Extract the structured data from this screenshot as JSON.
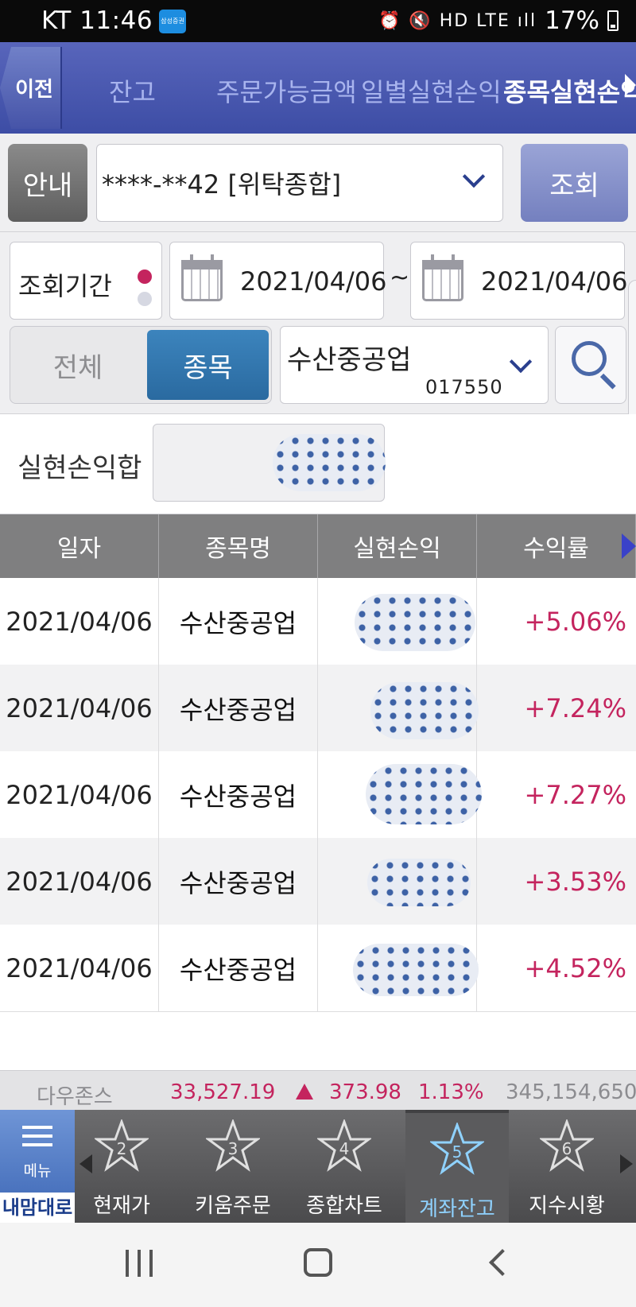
{
  "status_bar": {
    "carrier_time": "KT 11:46",
    "app_badge": "삼성증권",
    "battery_percent": "17%"
  },
  "header": {
    "back_label": "이전",
    "tabs": [
      {
        "label": "잔고"
      },
      {
        "label": "주문가능금액"
      },
      {
        "label": "일별실현손익"
      },
      {
        "label": "종목실현손익"
      }
    ],
    "active_tab": "종목실현손익"
  },
  "account": {
    "guide_label": "안내",
    "account_value": "****-**42 [위탁종합]",
    "query_label": "조회"
  },
  "filters": {
    "period_label": "조회기간",
    "start_date": "2021/04/06",
    "separator": "~",
    "end_date": "2021/04/06",
    "segment_all": "전체",
    "segment_stock": "종목",
    "stock_name": "수산중공업",
    "stock_code": "017550"
  },
  "summary": {
    "label": "실현손익합"
  },
  "table": {
    "columns": [
      "일자",
      "종목명",
      "실현손익",
      "수익률"
    ],
    "rows": [
      {
        "date": "2021/04/06",
        "name": "수산중공업",
        "rate": "+5.06%"
      },
      {
        "date": "2021/04/06",
        "name": "수산중공업",
        "rate": "+7.24%"
      },
      {
        "date": "2021/04/06",
        "name": "수산중공업",
        "rate": "+7.27%"
      },
      {
        "date": "2021/04/06",
        "name": "수산중공업",
        "rate": "+3.53%"
      },
      {
        "date": "2021/04/06",
        "name": "수산중공업",
        "rate": "+4.52%"
      }
    ]
  },
  "ticker": {
    "index_name": "다우존스",
    "value": "33,527.19",
    "change": "373.98",
    "percent": "1.13%",
    "volume": "345,154,650"
  },
  "bottom_nav": {
    "menu_label": "메뉴",
    "mydesk_label": "내맘대로",
    "items": [
      {
        "number": "2",
        "label": "현재가"
      },
      {
        "number": "3",
        "label": "키움주문"
      },
      {
        "number": "4",
        "label": "종합차트"
      },
      {
        "number": "5",
        "label": "계좌잔고"
      },
      {
        "number": "6",
        "label": "지수시황"
      }
    ],
    "active_item": "계좌잔고"
  },
  "colors": {
    "header_blue": "#3d4da5",
    "profit_red": "#c4245e",
    "segment_active": "#2a6aa0",
    "active_nav_label": "#8fd2ff"
  }
}
